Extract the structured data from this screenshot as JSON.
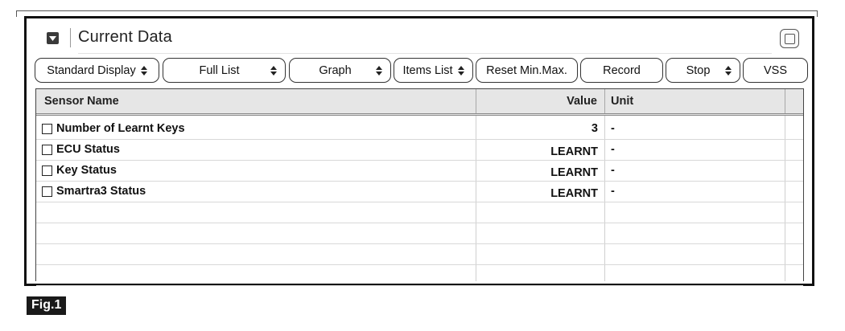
{
  "window": {
    "title": "Current Data"
  },
  "toolbar": {
    "standard_display": "Standard Display",
    "full_list": "Full List",
    "graph": "Graph",
    "items_list": "Items List",
    "reset_min_max": "Reset Min.Max.",
    "record": "Record",
    "stop": "Stop",
    "vss": "VSS"
  },
  "table": {
    "columns": {
      "sensor_name": "Sensor Name",
      "value": "Value",
      "unit": "Unit"
    },
    "rows": [
      {
        "name": "Number of Learnt Keys",
        "value": "3",
        "unit": "-"
      },
      {
        "name": "ECU Status",
        "value": "LEARNT",
        "unit": "-"
      },
      {
        "name": "Key Status",
        "value": "LEARNT",
        "unit": "-"
      },
      {
        "name": "Smartra3 Status",
        "value": "LEARNT",
        "unit": "-"
      }
    ]
  },
  "figure": {
    "label": "Fig.1"
  },
  "icons": {
    "collapse": "collapse-square-icon",
    "maximize": "maximize-window-icon",
    "dropdown": "up-down-arrows-icon",
    "checkbox": "checkbox-icon"
  }
}
